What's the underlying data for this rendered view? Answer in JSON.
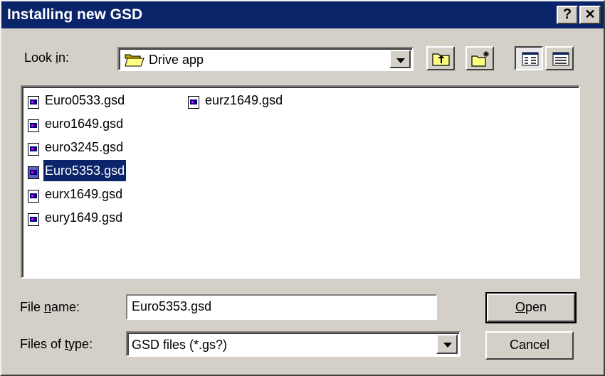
{
  "window": {
    "title": "Installing new GSD",
    "help_button": "?",
    "close_button": "✕"
  },
  "lookin": {
    "label_pre": "Look ",
    "label_u": "i",
    "label_post": "n:",
    "value": "Drive app"
  },
  "files": [
    {
      "name": "Euro0533.gsd",
      "selected": false
    },
    {
      "name": "euro1649.gsd",
      "selected": false
    },
    {
      "name": "euro3245.gsd",
      "selected": false
    },
    {
      "name": "Euro5353.gsd",
      "selected": true
    },
    {
      "name": "eurx1649.gsd",
      "selected": false
    },
    {
      "name": "eury1649.gsd",
      "selected": false
    },
    {
      "name": "eurz1649.gsd",
      "selected": false
    }
  ],
  "filename": {
    "label_pre": "File ",
    "label_u": "n",
    "label_post": "ame:",
    "value": "Euro5353.gsd"
  },
  "filetype": {
    "label_pre": "Files of ",
    "label_u": "t",
    "label_post": "ype:",
    "value": "GSD files (*.gs?)"
  },
  "buttons": {
    "open_u": "O",
    "open_rest": "pen",
    "cancel": "Cancel"
  },
  "colors": {
    "titlebar": "#0a246a",
    "dialog": "#d4d0c8",
    "selection": "#0a246a"
  }
}
